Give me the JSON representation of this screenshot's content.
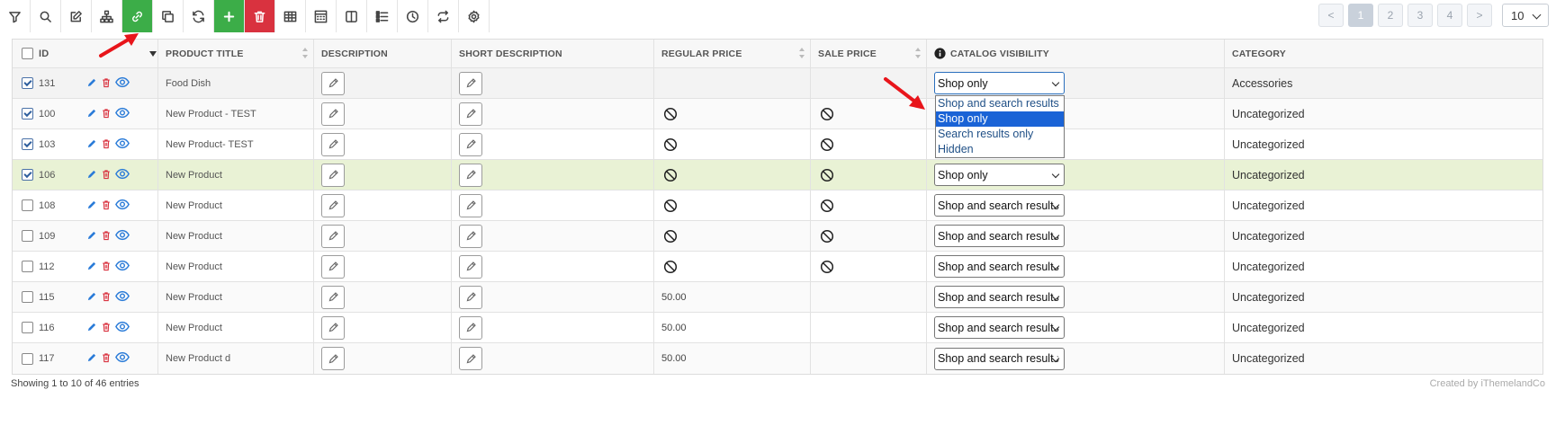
{
  "toolbar": {
    "buttons": [
      {
        "name": "filter-icon"
      },
      {
        "name": "search-icon"
      },
      {
        "name": "edit-icon"
      },
      {
        "name": "hierarchy-icon"
      },
      {
        "name": "link-icon",
        "active": true
      },
      {
        "name": "duplicate-icon"
      },
      {
        "name": "refresh-icon"
      },
      {
        "name": "add-icon"
      },
      {
        "name": "delete-icon"
      },
      {
        "name": "table-icon"
      },
      {
        "name": "calculator-icon"
      },
      {
        "name": "columns-icon"
      },
      {
        "name": "list-icon"
      },
      {
        "name": "history-icon"
      },
      {
        "name": "swap-icon"
      },
      {
        "name": "settings-icon"
      }
    ],
    "add_label": "+"
  },
  "pagination": {
    "prev": "<",
    "pages": [
      "1",
      "2",
      "3",
      "4"
    ],
    "next": ">",
    "per_page": "10"
  },
  "columns": {
    "id": "ID",
    "title": "PRODUCT TITLE",
    "description": "DESCRIPTION",
    "short_description": "SHORT DESCRIPTION",
    "regular_price": "REGULAR PRICE",
    "sale_price": "SALE PRICE",
    "catalog_visibility": "CATALOG VISIBILITY",
    "category": "CATEGORY"
  },
  "rows": [
    {
      "id": "131",
      "checked": true,
      "title": "Food Dish",
      "regular": "",
      "sale": "",
      "visibility": "Shop only",
      "category": "Accessories"
    },
    {
      "id": "100",
      "checked": true,
      "title": "New Product - TEST",
      "regular": "ban",
      "sale": "ban",
      "visibility": "",
      "category": "Uncategorized"
    },
    {
      "id": "103",
      "checked": true,
      "title": "New Product- TEST",
      "regular": "ban",
      "sale": "ban",
      "visibility": "",
      "category": "Uncategorized"
    },
    {
      "id": "106",
      "checked": true,
      "title": "New Product",
      "regular": "ban",
      "sale": "ban",
      "visibility": "Shop only",
      "category": "Uncategorized"
    },
    {
      "id": "108",
      "checked": false,
      "title": "New Product",
      "regular": "ban",
      "sale": "ban",
      "visibility": "Shop and search results",
      "category": "Uncategorized"
    },
    {
      "id": "109",
      "checked": false,
      "title": "New Product",
      "regular": "ban",
      "sale": "ban",
      "visibility": "Shop and search results",
      "category": "Uncategorized"
    },
    {
      "id": "112",
      "checked": false,
      "title": "New Product",
      "regular": "ban",
      "sale": "ban",
      "visibility": "Shop and search results",
      "category": "Uncategorized"
    },
    {
      "id": "115",
      "checked": false,
      "title": "New Product",
      "regular": "50.00",
      "sale": "",
      "visibility": "Shop and search results",
      "category": "Uncategorized"
    },
    {
      "id": "116",
      "checked": false,
      "title": "New Product",
      "regular": "50.00",
      "sale": "",
      "visibility": "Shop and search results",
      "category": "Uncategorized"
    },
    {
      "id": "117",
      "checked": false,
      "title": "New Product d",
      "regular": "50.00",
      "sale": "",
      "visibility": "Shop and search results",
      "category": "Uncategorized"
    }
  ],
  "visibility_options": [
    "Shop and search results",
    "Shop only",
    "Search results only",
    "Hidden"
  ],
  "visibility_selected": "Shop only",
  "footer": {
    "entries": "Showing 1 to 10 of 46 entries",
    "credit": "Created by iThemelandCo"
  },
  "colors": {
    "accent_green": "#3cad48",
    "accent_red": "#d9323f",
    "highlight_row": "#e9f2d5",
    "select_focus": "#2a6fbd",
    "option_selected": "#1a63d6",
    "annotation_arrow": "#e8151b"
  }
}
